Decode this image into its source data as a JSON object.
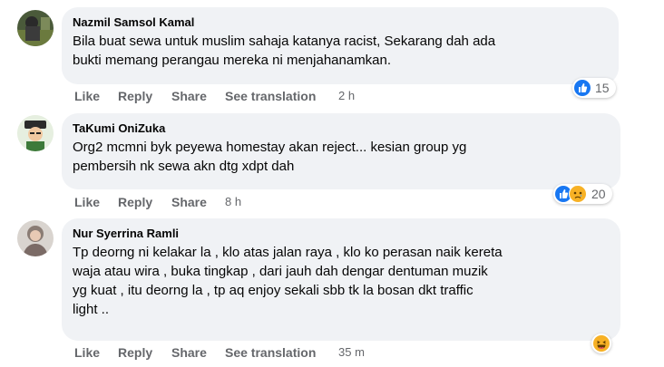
{
  "comments": [
    {
      "author": "Nazmil Samsol Kamal",
      "text": "Bila buat sewa untuk muslim sahaja katanya racist, Sekarang dah ada\nbukti memang perangau mereka ni menjahanamkan.",
      "actions": {
        "like": "Like",
        "reply": "Reply",
        "share": "Share",
        "translate": "See translation"
      },
      "time": "2 h",
      "reaction_count": "15",
      "reaction_icons": [
        "like-icon"
      ]
    },
    {
      "author": "TaKumi OniZuka",
      "text": "Org2 mcmni byk peyewa homestay akan reject... kesian group yg\npembersih nk sewa akn dtg xdpt dah",
      "actions": {
        "like": "Like",
        "reply": "Reply",
        "share": "Share"
      },
      "time": "8 h",
      "reaction_count": "20",
      "reaction_icons": [
        "like-icon",
        "sad-icon"
      ]
    },
    {
      "author": "Nur Syerrina Ramli",
      "text": "Tp deorng ni kelakar la , klo atas jalan raya , klo ko perasan naik kereta\nwaja atau wira , buka tingkap , dari jauh dah dengar dentuman muzik\nyg kuat , itu deorng la , tp aq enjoy sekali sbb tk la bosan dkt traffic\nlight ..",
      "actions": {
        "like": "Like",
        "reply": "Reply",
        "share": "Share",
        "translate": "See translation"
      },
      "time": "35 m",
      "reaction_icons": [
        "haha-icon"
      ]
    }
  ],
  "colors": {
    "bubble": "#f0f2f5",
    "action": "#65676b",
    "like": "#1877f2",
    "haha": "#f7b125"
  }
}
